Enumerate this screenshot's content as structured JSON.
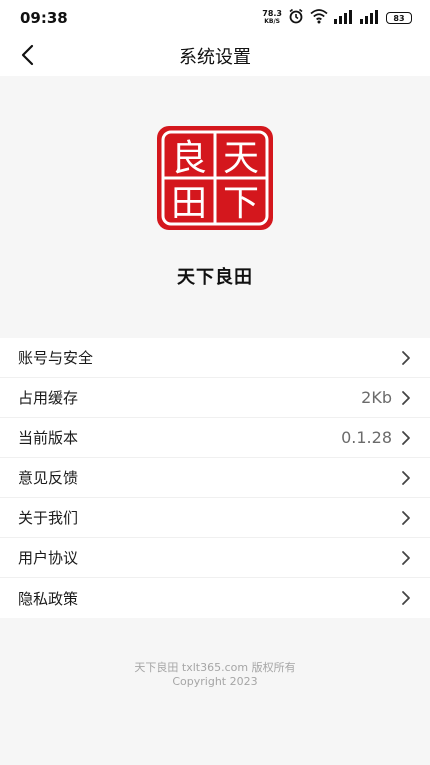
{
  "status_bar": {
    "time": "09:38",
    "net_speed_value": "78.3",
    "net_speed_unit": "KB/S",
    "battery": "83"
  },
  "header": {
    "title": "系统设置"
  },
  "app": {
    "name": "天下良田",
    "logo_chars": [
      "良",
      "天",
      "田",
      "下"
    ],
    "logo_color": "#d4171d"
  },
  "settings": {
    "items": [
      {
        "label": "账号与安全",
        "value": ""
      },
      {
        "label": "占用缓存",
        "value": "2Kb"
      },
      {
        "label": "当前版本",
        "value": "0.1.28"
      },
      {
        "label": "意见反馈",
        "value": ""
      },
      {
        "label": "关于我们",
        "value": ""
      },
      {
        "label": "用户协议",
        "value": ""
      },
      {
        "label": "隐私政策",
        "value": ""
      }
    ]
  },
  "footer": {
    "line1": "天下良田 txlt365.com 版权所有",
    "line2": "Copyright 2023"
  }
}
